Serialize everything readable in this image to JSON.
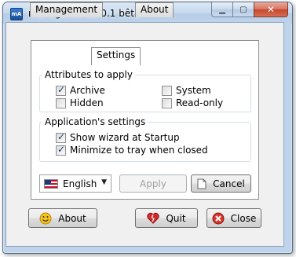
{
  "window": {
    "title": "manageAttribs 0.1 bêta",
    "icon": "app-icon"
  },
  "tabs": [
    {
      "label": "Management"
    },
    {
      "label": "Settings"
    },
    {
      "label": "About"
    }
  ],
  "attributes_group": {
    "title": "Attributes to apply",
    "items": [
      {
        "label": "Archive",
        "checked": true
      },
      {
        "label": "Hidden",
        "checked": false
      },
      {
        "label": "System",
        "checked": false
      },
      {
        "label": "Read-only",
        "checked": false
      }
    ]
  },
  "app_settings_group": {
    "title": "Application's settings",
    "items": [
      {
        "label": "Show wizard at Startup",
        "checked": true
      },
      {
        "label": "Minimize to tray when closed",
        "checked": true
      }
    ]
  },
  "language_select": {
    "value": "English",
    "icon": "us-flag-icon"
  },
  "buttons": {
    "apply": "Apply",
    "cancel": "Cancel",
    "about": "About",
    "quit": "Quit",
    "close": "Close"
  },
  "colors": {
    "accent": "#1c3b78",
    "titlebar": "#bfd4ea",
    "close_button": "#d9352a"
  }
}
